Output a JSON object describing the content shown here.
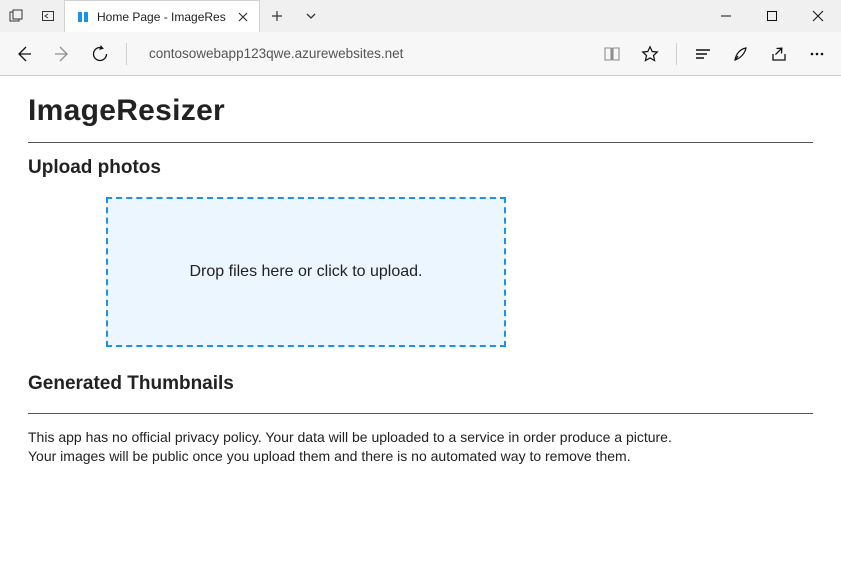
{
  "window": {
    "tab_title": "Home Page - ImageRes"
  },
  "toolbar": {
    "address": "contosowebapp123qwe.azurewebsites.net"
  },
  "content": {
    "heading": "ImageResizer",
    "upload_heading": "Upload photos",
    "dropzone_text": "Drop files here or click to upload.",
    "thumbnails_heading": "Generated Thumbnails",
    "privacy_line1": "This app has no official privacy policy. Your data will be uploaded to a service in order produce a picture.",
    "privacy_line2": "Your images will be public once you upload them and there is no automated way to remove them."
  }
}
